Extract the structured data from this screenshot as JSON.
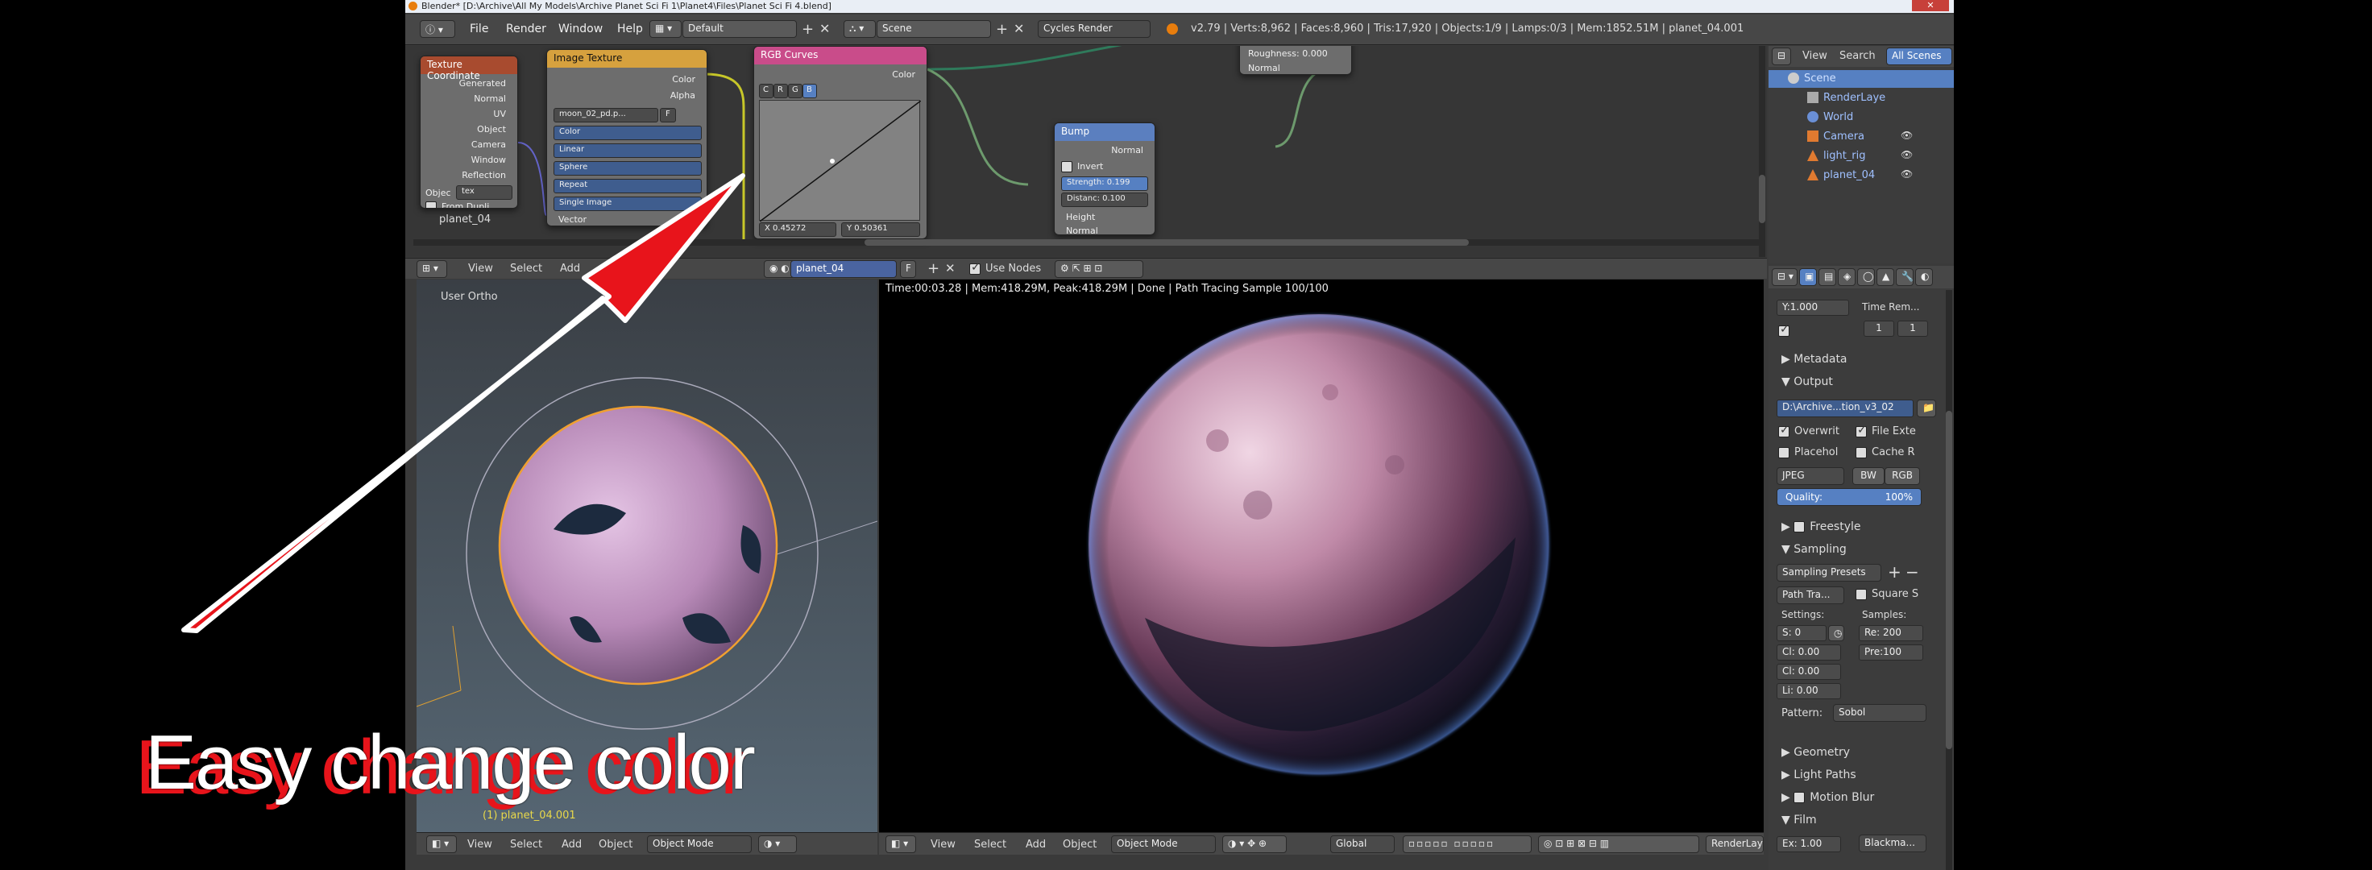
{
  "title_bar": "Blender* [D:\\Archive\\All My Models\\Archive Planet Sci Fi 1\\Planet4\\Files\\Planet Sci Fi 4.blend]",
  "menu": [
    "File",
    "Render",
    "Window",
    "Help"
  ],
  "layout_name": "Default",
  "scene_name": "Scene",
  "engine": "Cycles Render",
  "stats": "v2.79 | Verts:8,962 | Faces:8,960 | Tris:17,920 | Objects:1/9 | Lamps:0/3 | Mem:1852.51M | planet_04.001",
  "node_editor": {
    "tex_coord": {
      "title": "Texture Coordinate",
      "outputs": [
        "Generated",
        "Normal",
        "UV",
        "Object",
        "Camera",
        "Window",
        "Reflection"
      ],
      "object_label": "Objec",
      "object_value": "tex",
      "from_dupli": "From Dupli"
    },
    "image_texture": {
      "title": "Image Texture",
      "outputs": [
        "Color",
        "Alpha"
      ],
      "image": "moon_02_pd.p...",
      "image_f": "F",
      "color_mode": "Color",
      "interpolation": "Linear",
      "projection": "Sphere",
      "extension": "Repeat",
      "source": "Single Image",
      "input": "Vector"
    },
    "rgb_curves": {
      "title": "RGB Curves",
      "output": "Color",
      "channels": [
        "C",
        "R",
        "G",
        "B"
      ],
      "x_readout": "X 0.45272",
      "y_readout": "Y 0.50361"
    },
    "bump": {
      "title": "Bump",
      "output": "Normal",
      "invert": "Invert",
      "strength": "Strength: 0.199",
      "distance": "Distanc: 0.100",
      "inputs": [
        "Height",
        "Normal"
      ]
    },
    "top_node": {
      "roughness": "Roughness: 0.000",
      "normal": "Normal"
    },
    "material_label": "planet_04",
    "header": {
      "view": "View",
      "select": "Select",
      "add": "Add",
      "material": "planet_04",
      "f": "F",
      "use_nodes": "Use Nodes"
    }
  },
  "outliner": {
    "header": {
      "view": "View",
      "search": "Search",
      "scenes": "All Scenes"
    },
    "items": [
      "Scene",
      "RenderLaye",
      "World",
      "Camera",
      "light_rig",
      "planet_04"
    ]
  },
  "viewport_left": {
    "label": "User Ortho",
    "object_label": "(1) planet_04.001",
    "header": {
      "view": "View",
      "select": "Select",
      "add": "Add",
      "object": "Object",
      "mode": "Object Mode"
    }
  },
  "render_view": {
    "info": "Time:00:03.28 | Mem:418.29M, Peak:418.29M | Done | Path Tracing Sample 100/100",
    "header": {
      "view": "View",
      "select": "Select",
      "add": "Add",
      "object": "Object",
      "mode": "Object Mode",
      "orientation": "Global",
      "render_layer": "RenderLay"
    }
  },
  "properties": {
    "y_field": "Y:1.000",
    "time_rem": "Time Rem...",
    "frame_a": "1",
    "frame_b": "1",
    "metadata": "Metadata",
    "output": "Output",
    "output_path": "D:\\Archive...tion_v3_02",
    "overwrite": "Overwrit",
    "file_ext": "File Exte",
    "placeholder": "Placehol",
    "cache": "Cache R",
    "format": "JPEG",
    "bw": "BW",
    "rgb": "RGB",
    "quality_label": "Quality:",
    "quality_value": "100%",
    "freestyle": "Freestyle",
    "sampling": "Sampling",
    "sampling_presets": "Sampling Presets",
    "integrator": "Path Tra...",
    "square": "Square S",
    "settings": "Settings:",
    "samples": "Samples:",
    "seed": "S: 0",
    "clamp1": "Cl: 0.00",
    "clamp2": "Cl: 0.00",
    "light": "Li: 0.00",
    "render_samples": "Re: 200",
    "preview_samples": "Pre:100",
    "pattern_label": "Pattern:",
    "pattern_value": "Sobol",
    "geometry": "Geometry",
    "light_paths": "Light Paths",
    "motion_blur": "Motion Blur",
    "film": "Film",
    "exposure": "Ex: 1.00",
    "filter": "Blackma..."
  },
  "overlay_caption": "Easy change color",
  "colors": {
    "accent_blue": "#5680c2",
    "arrow_red": "#e8141b",
    "caption_red": "#e8141b",
    "selection_orange": "#f0a030"
  }
}
